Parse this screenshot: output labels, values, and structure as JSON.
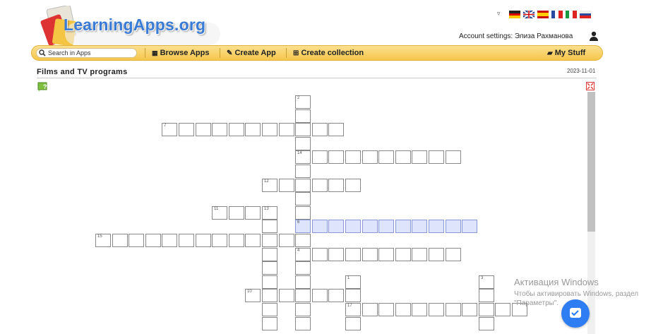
{
  "brand": {
    "name": "LearningApps.org",
    "accent": "#3a7bd5"
  },
  "languages": [
    "Deutsch",
    "English",
    "Español",
    "Français",
    "Italiano",
    "Русский"
  ],
  "account": {
    "label": "Account settings: Элиза Рахманова"
  },
  "nav": {
    "search_placeholder": "Search in Apps",
    "browse": "Browse Apps",
    "create_app": "Create App",
    "create_collection": "Create collection",
    "my_stuff": "My Stuff",
    "bar_color": "#f5c64a"
  },
  "page": {
    "title": "Films and TV programs",
    "date": "2023-11-01"
  },
  "crossword": {
    "numbers": [
      "1",
      "2",
      "3",
      "4",
      "6",
      "7",
      "10",
      "11",
      "12",
      "13",
      "14",
      "15",
      "17"
    ],
    "highlight_color": "#dde4fc"
  },
  "watermark": {
    "title": "Активация Windows",
    "line": "Чтобы активировать Windows, раздел \"Параметры\"."
  },
  "icons": [
    "search-icon",
    "grid-icon",
    "pencil-icon",
    "collection-icon",
    "folder-icon",
    "user-icon",
    "help-icon",
    "fullscreen-icon",
    "chat-icon"
  ]
}
